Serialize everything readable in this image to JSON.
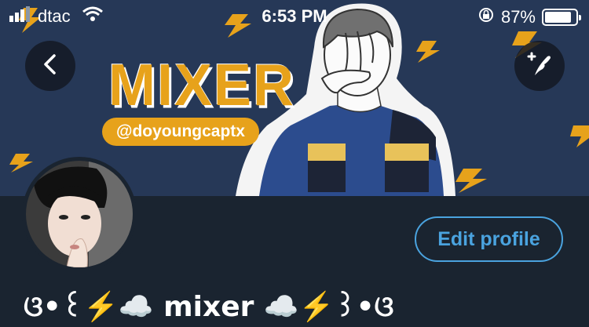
{
  "status_bar": {
    "carrier": "dtac",
    "time": "6:53 PM",
    "battery_percent_text": "87%",
    "battery_level": 0.87
  },
  "header": {
    "banner_title": "MIXER",
    "banner_handle": "@doyoungcaptx"
  },
  "profile": {
    "edit_button_label": "Edit profile",
    "display_name": "ଓ•꒰⚡️☁️ mixer ☁️⚡️꒱•ଓ"
  },
  "colors": {
    "banner_bg": "#263857",
    "accent_yellow": "#e7a21b",
    "profile_bg": "#1a2430",
    "link_blue": "#4aa3df"
  }
}
